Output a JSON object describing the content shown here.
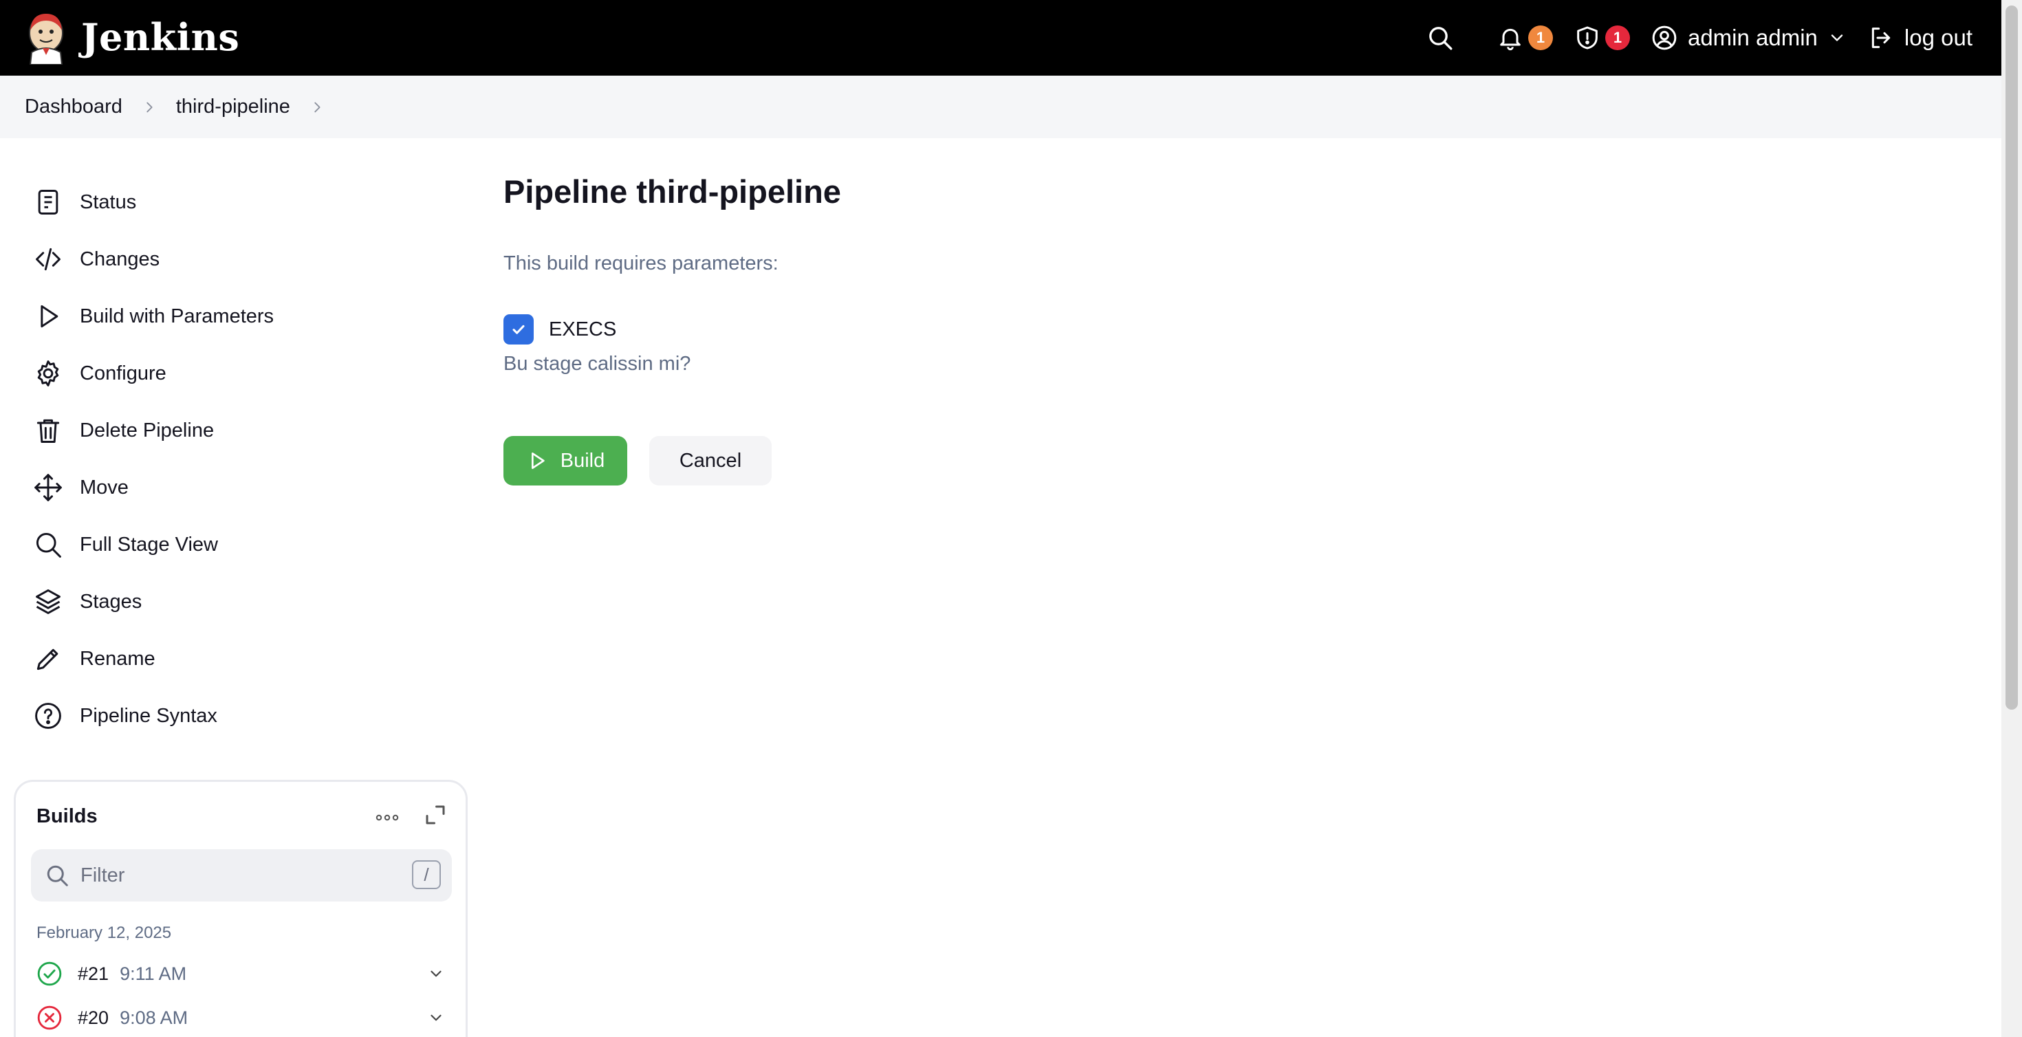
{
  "header": {
    "brand_name": "Jenkins",
    "notifications_count": "1",
    "security_count": "1",
    "user_name": "admin admin",
    "logout_label": "log out",
    "colors": {
      "bg": "#000000",
      "badge_notifications": "#f0883e",
      "badge_security": "#e5283c"
    },
    "icons": [
      "search-icon",
      "bell-icon",
      "shield-icon",
      "user-icon",
      "chevron-down-icon",
      "logout-icon"
    ]
  },
  "breadcrumb": {
    "items": [
      {
        "label": "Dashboard"
      },
      {
        "label": "third-pipeline"
      }
    ]
  },
  "sidebar": {
    "items": [
      {
        "label": "Status",
        "icon": "document-icon"
      },
      {
        "label": "Changes",
        "icon": "code-icon"
      },
      {
        "label": "Build with Parameters",
        "icon": "play-icon"
      },
      {
        "label": "Configure",
        "icon": "gear-icon"
      },
      {
        "label": "Delete Pipeline",
        "icon": "trash-icon"
      },
      {
        "label": "Move",
        "icon": "move-icon"
      },
      {
        "label": "Full Stage View",
        "icon": "search-icon"
      },
      {
        "label": "Stages",
        "icon": "layers-icon"
      },
      {
        "label": "Rename",
        "icon": "pencil-icon"
      },
      {
        "label": "Pipeline Syntax",
        "icon": "help-icon"
      }
    ]
  },
  "builds": {
    "title": "Builds",
    "filter_placeholder": "Filter",
    "filter_shortcut": "/",
    "date": "February 12, 2025",
    "rows": [
      {
        "number": "#21",
        "time": "9:11 AM",
        "status": "success",
        "status_color": "#1ea64b"
      },
      {
        "number": "#20",
        "time": "9:08 AM",
        "status": "failure",
        "status_color": "#e5283c"
      }
    ]
  },
  "main": {
    "title": "Pipeline third-pipeline",
    "description": "This build requires parameters:",
    "parameter": {
      "name": "EXECS",
      "checked": true,
      "help": "Bu stage calissin mi?"
    },
    "build_label": "Build",
    "cancel_label": "Cancel",
    "colors": {
      "build_button": "#4caf50",
      "checkbox": "#2e6de0"
    }
  }
}
